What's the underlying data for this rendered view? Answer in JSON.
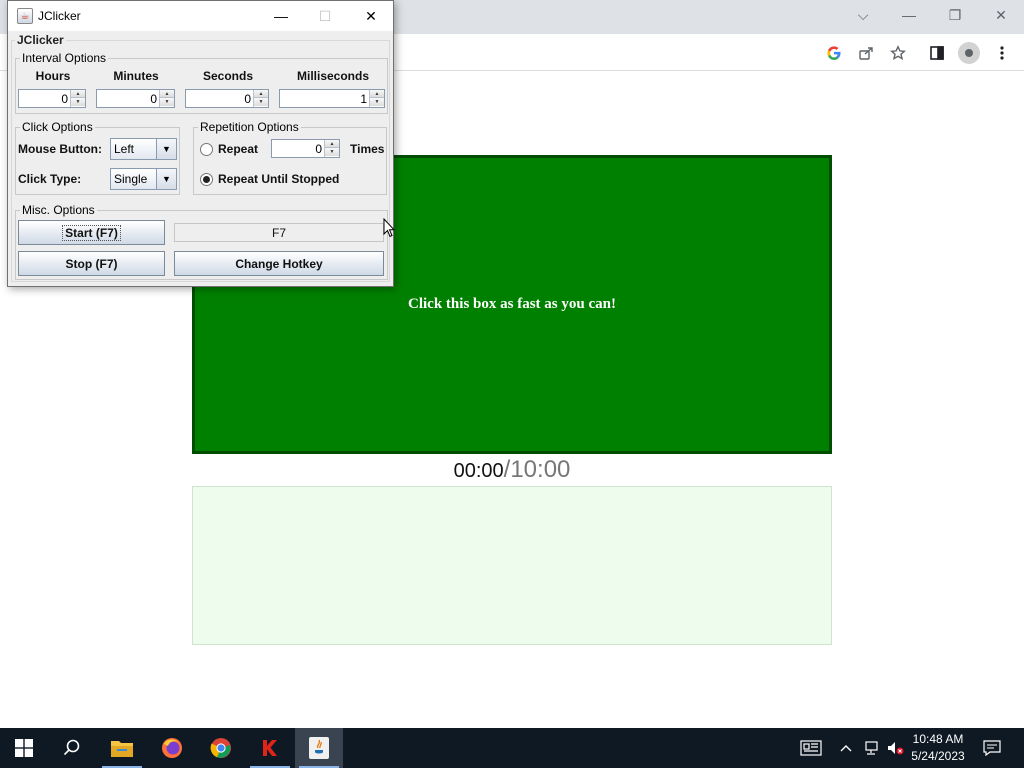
{
  "browser": {
    "window_controls": {
      "tab_list": "⌵",
      "minimize": "—",
      "restore": "❐",
      "close": "✕"
    },
    "toolbar_icons": [
      "google-icon",
      "share-icon",
      "star-icon",
      "sidebar-icon",
      "profile-icon",
      "menu-icon"
    ]
  },
  "page": {
    "click_box_text": "Click this box as fast as you can!",
    "timer_elapsed": "00:00",
    "timer_separator": "/",
    "timer_total": "10:00",
    "click_box_color": "#008000",
    "results_box_color": "#eefcee"
  },
  "jclicker": {
    "window_title": "JClicker",
    "window_controls": {
      "minimize": "—",
      "maximize": "☐",
      "close": "✕"
    },
    "panel_title": "JClicker",
    "interval": {
      "title": "Interval Options",
      "hours_label": "Hours",
      "hours_value": "0",
      "minutes_label": "Minutes",
      "minutes_value": "0",
      "seconds_label": "Seconds",
      "seconds_value": "0",
      "milliseconds_label": "Milliseconds",
      "milliseconds_value": "1"
    },
    "click_options": {
      "title": "Click Options",
      "mouse_button_label": "Mouse Button:",
      "mouse_button_value": "Left",
      "click_type_label": "Click Type:",
      "click_type_value": "Single"
    },
    "repetition": {
      "title": "Repetition Options",
      "repeat_label": "Repeat",
      "repeat_value": "0",
      "times_label": "Times",
      "repeat_until_stopped_label": "Repeat Until Stopped",
      "selected": "repeat_until_stopped"
    },
    "misc": {
      "title": "Misc. Options",
      "start_label": "Start (F7)",
      "hotkey_value": "F7",
      "stop_label": "Stop (F7)",
      "change_hotkey_label": "Change Hotkey"
    }
  },
  "taskbar": {
    "apps": [
      "windows-start-icon",
      "search-icon",
      "file-explorer-icon",
      "firefox-icon",
      "chrome-icon",
      "k-app-icon",
      "java-icon"
    ],
    "time": "10:48 AM",
    "date": "5/24/2023"
  }
}
